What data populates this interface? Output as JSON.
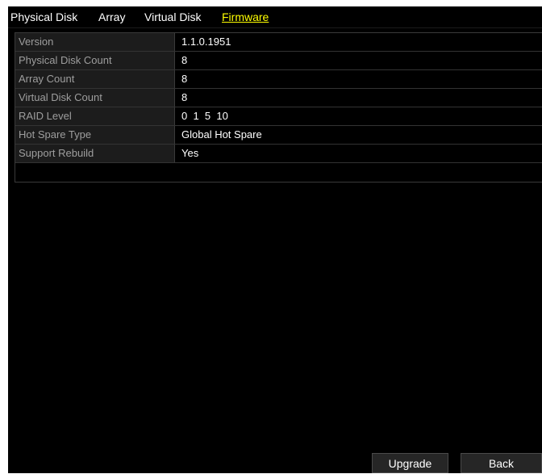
{
  "tabs": [
    {
      "label": "Physical Disk",
      "active": false
    },
    {
      "label": "Array",
      "active": false
    },
    {
      "label": "Virtual Disk",
      "active": false
    },
    {
      "label": "Firmware",
      "active": true
    }
  ],
  "firmware": {
    "rows": [
      {
        "label": "Version",
        "value": "1.1.0.1951"
      },
      {
        "label": "Physical Disk Count",
        "value": "8"
      },
      {
        "label": "Array Count",
        "value": "8"
      },
      {
        "label": "Virtual Disk Count",
        "value": "8"
      },
      {
        "label": "RAID Level",
        "value": "0  1  5  10"
      },
      {
        "label": "Hot Spare Type",
        "value": "Global Hot Spare"
      },
      {
        "label": "Support Rebuild",
        "value": "Yes"
      }
    ]
  },
  "buttons": {
    "upgrade": "Upgrade",
    "back": "Back"
  },
  "colors": {
    "background": "#000000",
    "active_tab": "#ffff00",
    "label_text": "#9e9e9e",
    "value_text": "#ffffff"
  }
}
